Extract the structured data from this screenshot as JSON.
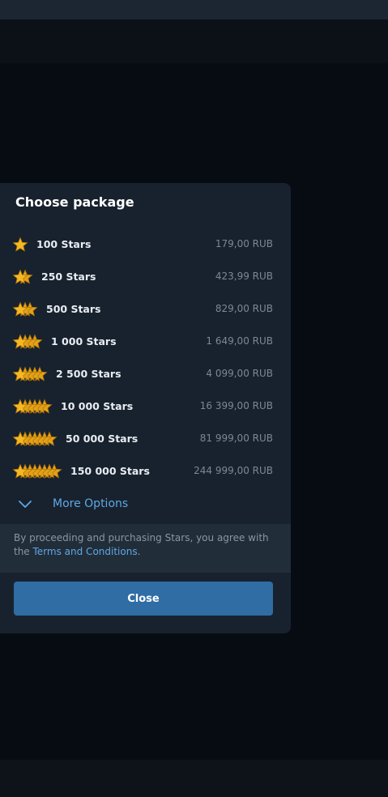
{
  "dialog": {
    "title": "Choose package",
    "packages": [
      {
        "label": "100 Stars",
        "price": "179,00 RUB",
        "icon": "star-1-icon"
      },
      {
        "label": "250 Stars",
        "price": "423,99 RUB",
        "icon": "star-stack-2-icon"
      },
      {
        "label": "500 Stars",
        "price": "829,00 RUB",
        "icon": "star-stack-3-icon"
      },
      {
        "label": "1 000 Stars",
        "price": "1 649,00 RUB",
        "icon": "star-stack-4-icon"
      },
      {
        "label": "2 500 Stars",
        "price": "4 099,00 RUB",
        "icon": "star-stack-5-icon"
      },
      {
        "label": "10 000 Stars",
        "price": "16 399,00 RUB",
        "icon": "star-stack-6-icon"
      },
      {
        "label": "50 000 Stars",
        "price": "81 999,00 RUB",
        "icon": "star-stack-7-icon"
      },
      {
        "label": "150 000 Stars",
        "price": "244 999,00 RUB",
        "icon": "star-stack-8-icon"
      }
    ],
    "more_options": {
      "label": "More Options",
      "icon": "chevron-down-icon"
    },
    "terms": {
      "text_before": "By proceeding and purchasing Stars, you agree with the ",
      "link": "Terms and Conditions",
      "text_after": "."
    },
    "close_label": "Close",
    "colors": {
      "accent": "#5ea8e4",
      "button": "#2f6da4",
      "star": "#f5b823",
      "panel": "#18222e"
    }
  }
}
